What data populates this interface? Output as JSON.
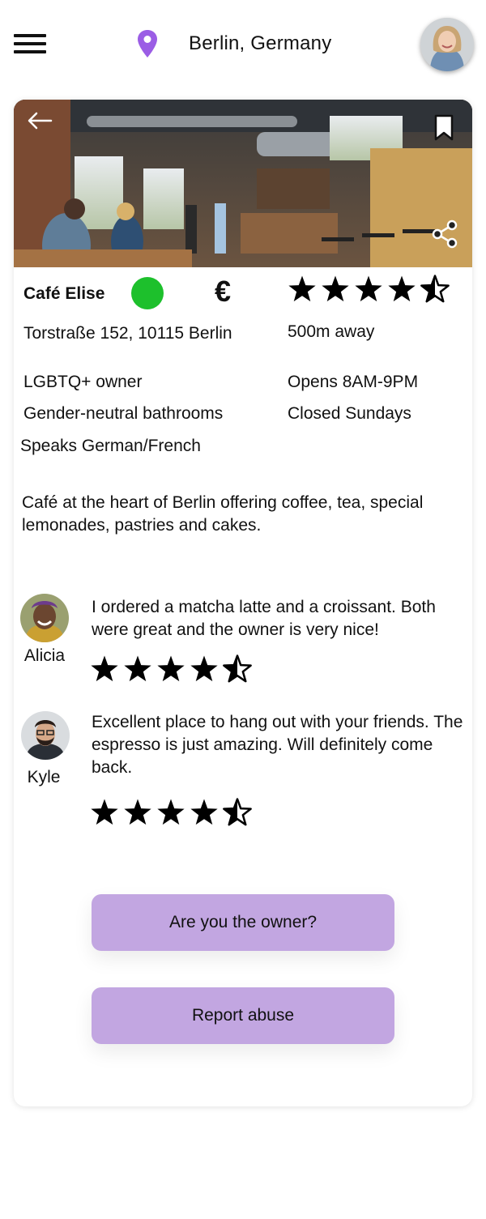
{
  "header": {
    "location": "Berlin, Germany"
  },
  "place": {
    "name": "Café Elise",
    "price_symbol": "€",
    "rating": 4.5,
    "address": "Torstraße 152, 10115 Berlin",
    "distance": "500m away",
    "features": [
      "LGBTQ+ owner",
      "Gender-neutral bathrooms",
      "Speaks German/French"
    ],
    "hours": [
      "Opens 8AM-9PM",
      "Closed Sundays"
    ],
    "description": "Café at the heart of Berlin offering coffee, tea, special lemonades, pastries and cakes.",
    "status_color": "#1dc02c"
  },
  "reviews": [
    {
      "name": "Alicia",
      "text": "I ordered a matcha latte and a croissant. Both were great and the owner is very nice!",
      "rating": 4.5
    },
    {
      "name": "Kyle",
      "text": "Excellent place to hang out with your friends. The espresso is just amazing. Will definitely come back.",
      "rating": 4.5
    }
  ],
  "actions": {
    "owner_label": "Are you the owner?",
    "report_label": "Report abuse"
  },
  "colors": {
    "accent": "#9b5de5",
    "button": "#c2a6e1",
    "status_open": "#1dc02c"
  },
  "icons": [
    "menu-icon",
    "location-pin-icon",
    "back-arrow-icon",
    "bookmark-icon",
    "share-icon",
    "star-icon"
  ]
}
